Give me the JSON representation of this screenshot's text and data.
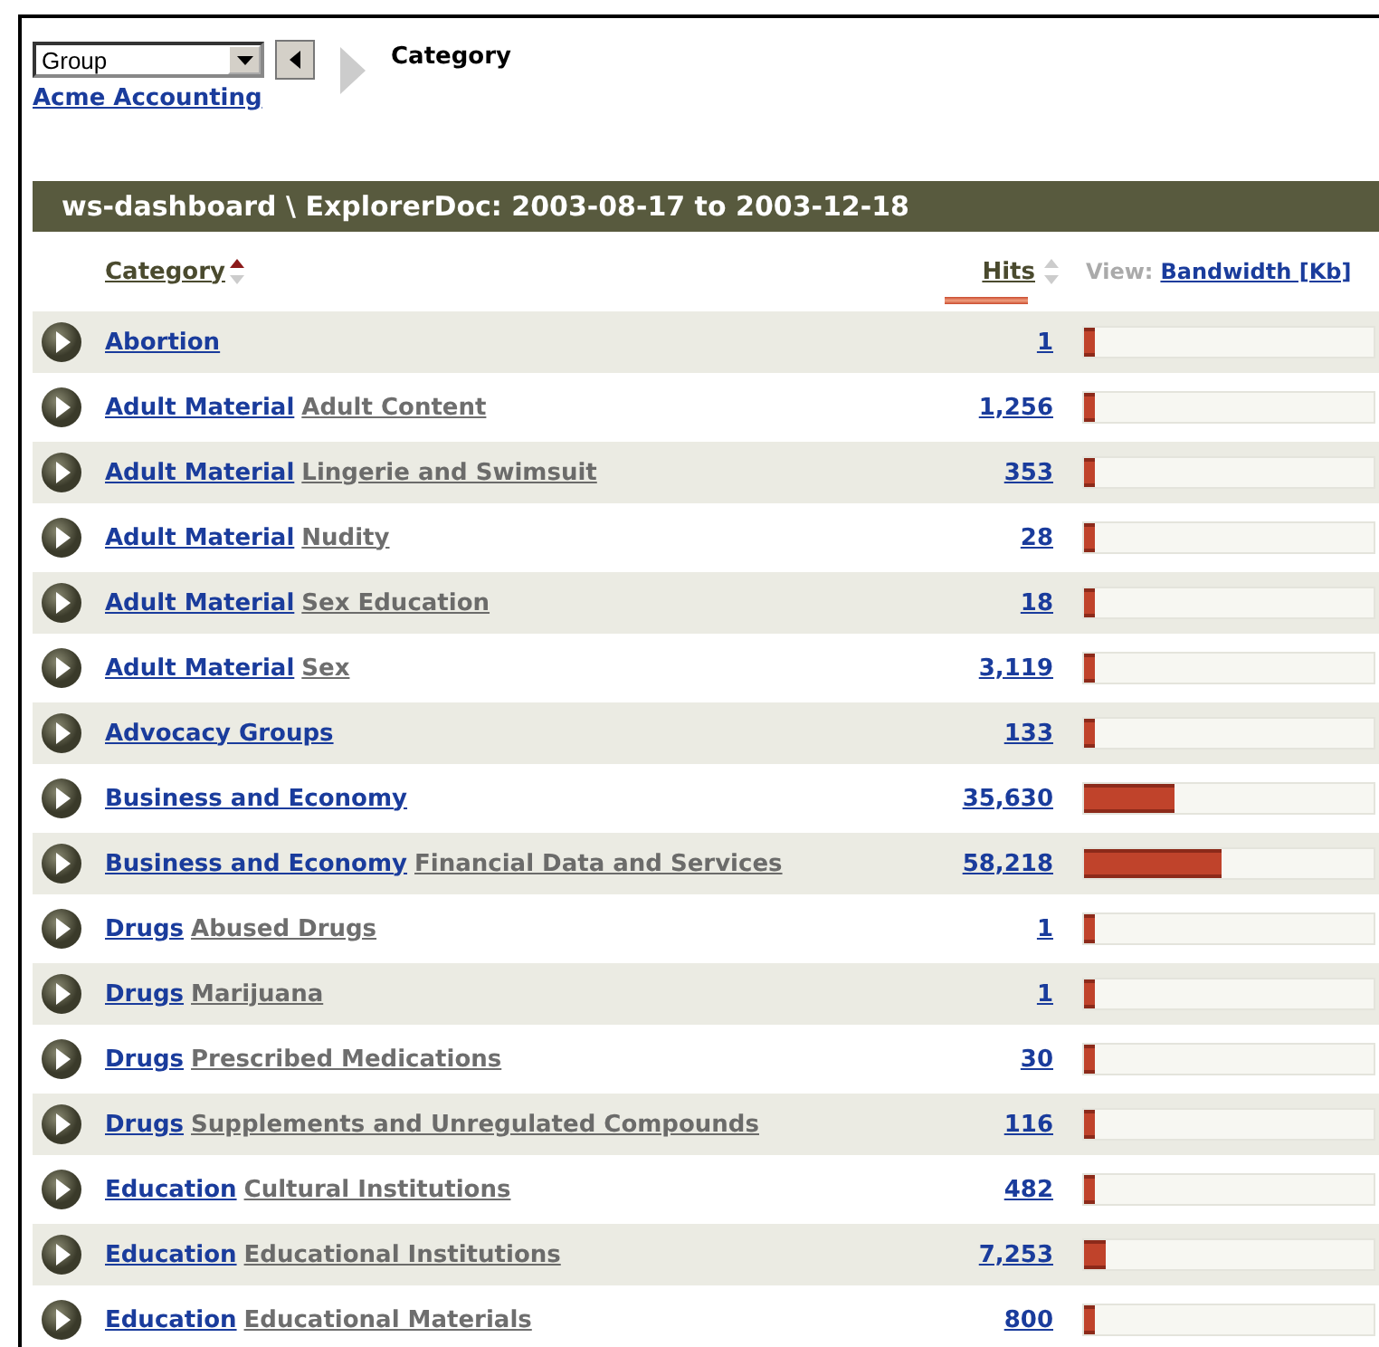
{
  "toolbar": {
    "group_select": {
      "value": "Group"
    },
    "crumb": "Category",
    "link": "Acme Accounting"
  },
  "report": {
    "title": "ws-dashboard \\ ExplorerDoc: 2003-08-17 to 2003-12-18",
    "columns": {
      "category": {
        "label": "Category",
        "sorted": true
      },
      "hits": {
        "label": "Hits",
        "sorted": false
      },
      "view_label": "View:",
      "view_link": "Bandwidth [Kb]"
    },
    "rows": [
      {
        "group": "Abortion",
        "hits": "1",
        "level": 0.04
      },
      {
        "group": "Adult Material",
        "sub": "Adult Content",
        "hits": "1,256",
        "level": 0.04
      },
      {
        "group": "Adult Material",
        "sub": "Lingerie and Swimsuit",
        "hits": "353",
        "level": 0.04
      },
      {
        "group": "Adult Material",
        "sub": "Nudity",
        "hits": "28",
        "level": 0.04
      },
      {
        "group": "Adult Material",
        "sub": "Sex Education",
        "hits": "18",
        "level": 0.04
      },
      {
        "group": "Adult Material",
        "sub": "Sex",
        "hits": "3,119",
        "level": 0.04
      },
      {
        "group": "Advocacy Groups",
        "hits": "133",
        "level": 0.04
      },
      {
        "group": "Business and Economy",
        "hits": "35,630",
        "level": 0.31
      },
      {
        "group": "Business and Economy",
        "sub": "Financial Data and Services",
        "hits": "58,218",
        "level": 0.475
      },
      {
        "group": "Drugs",
        "sub": "Abused Drugs",
        "hits": "1",
        "level": 0.04
      },
      {
        "group": "Drugs",
        "sub": "Marijuana",
        "hits": "1",
        "level": 0.04
      },
      {
        "group": "Drugs",
        "sub": "Prescribed Medications",
        "hits": "30",
        "level": 0.04
      },
      {
        "group": "Drugs",
        "sub": "Supplements and Unregulated Compounds",
        "hits": "116",
        "level": 0.04
      },
      {
        "group": "Education",
        "sub": "Cultural Institutions",
        "hits": "482",
        "level": 0.04
      },
      {
        "group": "Education",
        "sub": "Educational Institutions",
        "hits": "7,253",
        "level": 0.075
      },
      {
        "group": "Education",
        "sub": "Educational Materials",
        "hits": "800",
        "level": 0.04
      }
    ]
  }
}
